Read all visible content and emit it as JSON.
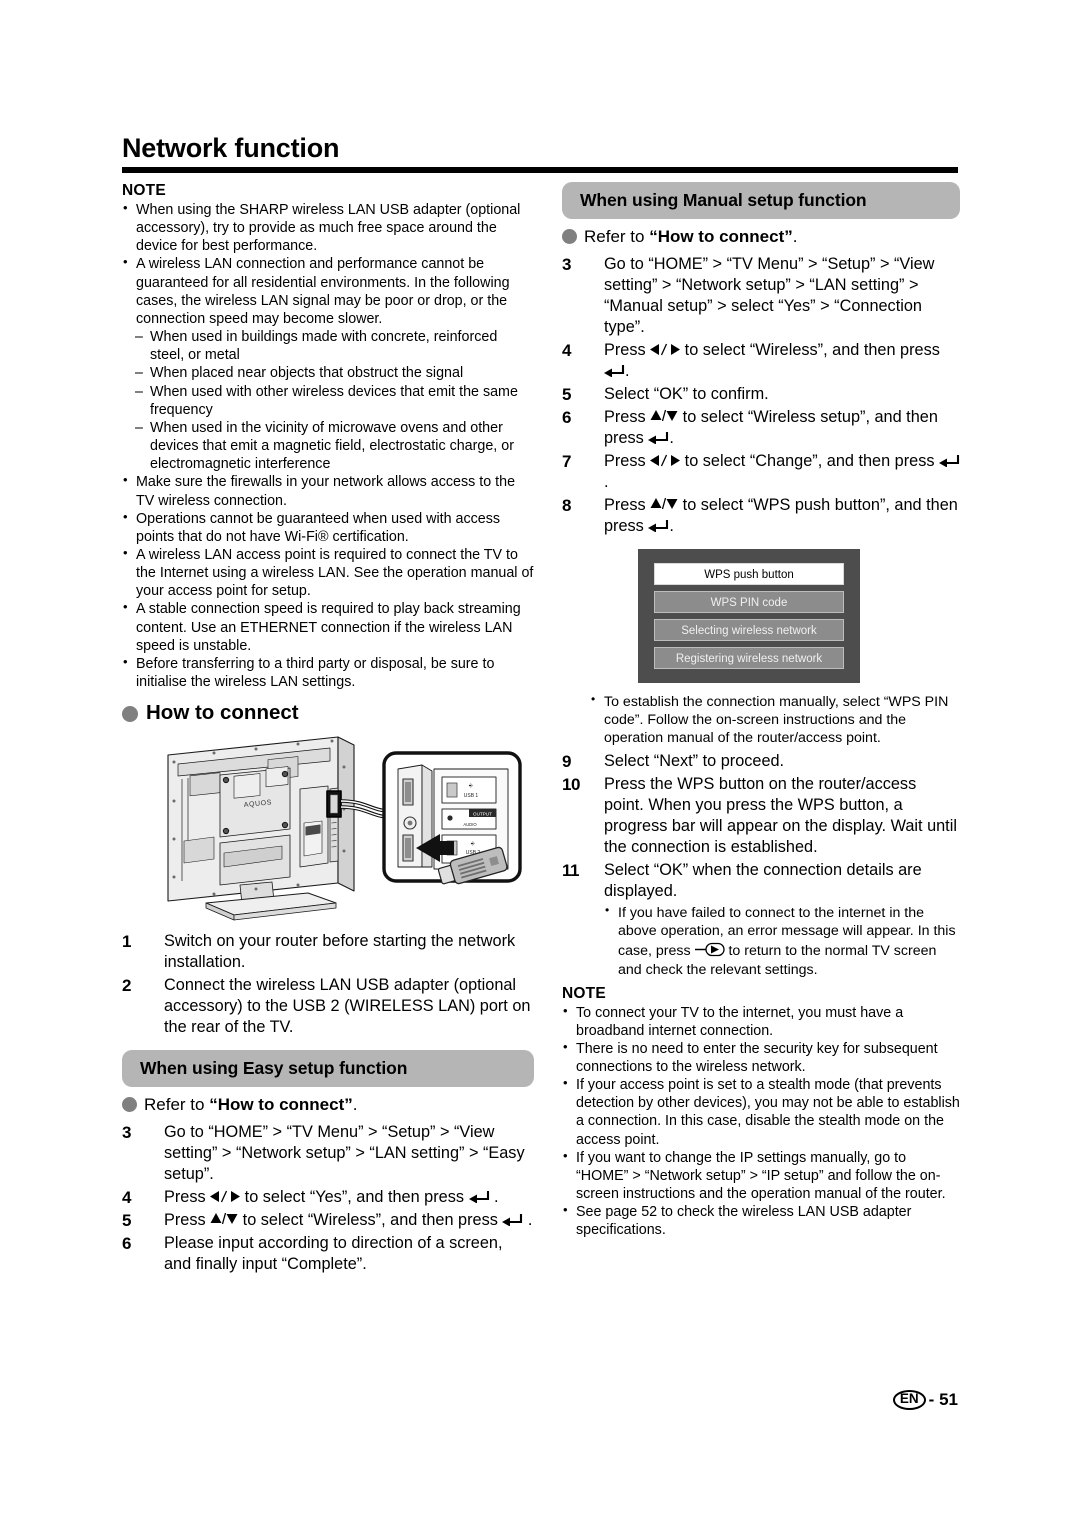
{
  "page": {
    "title": "Network function",
    "footer_lang": "EN",
    "footer_sep": "-",
    "footer_page": "51"
  },
  "left": {
    "note_label": "NOTE",
    "notes": [
      "When using the SHARP wireless LAN USB adapter (optional accessory), try to provide as much free space around the device for best performance.",
      "A wireless LAN connection and performance cannot be guaranteed for all residential environments. In the following cases, the wireless LAN signal may be poor or drop, or the connection speed may become slower."
    ],
    "sub_dashes": [
      "When used in buildings made with concrete, reinforced steel, or metal",
      "When placed near objects that obstruct the signal",
      "When used with other wireless devices that emit the same frequency",
      "When used in the vicinity of microwave ovens and other devices that emit a magnetic field, electrostatic charge, or electromagnetic interference"
    ],
    "notes_cont": [
      "Make sure the firewalls in your network allows access to the TV wireless connection.",
      "Operations cannot be guaranteed when used with access points that do not have Wi-Fi® certification.",
      "A wireless LAN access point is required to connect the TV to the Internet using a wireless LAN. See the operation manual of your access point for setup.",
      "A stable connection speed is required to play back streaming content. Use an ETHERNET connection if the wireless LAN speed is unstable.",
      "Before transferring to a third party or disposal, be sure to initialise the wireless LAN settings."
    ],
    "how_to_connect_heading": "How to connect",
    "figure": {
      "brand_label": "AQUOS",
      "port_label_usb1": "USB 1",
      "port_label_output": "OUTPUT",
      "port_label_usb2": "USB 2"
    },
    "steps": [
      {
        "num": "1",
        "text": "Switch on your router before starting the network installation."
      },
      {
        "num": "2",
        "text": "Connect the wireless LAN USB adapter (optional accessory) to the USB 2 (WIRELESS LAN) port on the rear of the TV."
      }
    ],
    "easy_bar": "When using Easy setup function",
    "easy_refer_prefix": "Refer to ",
    "easy_refer_bold": "“How to connect”",
    "easy_refer_suffix": ".",
    "easy_steps": {
      "s3_num": "3",
      "s3_text": "Go to “HOME” > “TV Menu” > “Setup” > “View setting” > “Network setup” > “LAN setting” > “Easy setup”.",
      "s4_num": "4",
      "s4_a": "Press ",
      "s4_b": " to select “Yes”, and then press ",
      "s4_c": " .",
      "s5_num": "5",
      "s5_a": "Press ",
      "s5_b": " to select “Wireless”, and then press ",
      "s5_c": " .",
      "s6_num": "6",
      "s6_text": "Please input according to direction of a screen, and finally input “Complete”."
    }
  },
  "right": {
    "manual_bar": "When using Manual setup function",
    "refer_prefix": "Refer to ",
    "refer_bold": "“How to connect”",
    "refer_suffix": ".",
    "steps": {
      "s3_num": "3",
      "s3_text": "Go to “HOME” > “TV Menu” > “Setup” > “View setting” > “Network setup” > “LAN setting” > “Manual setup” > select “Yes” > “Connection type”.",
      "s4_num": "4",
      "s4_a": "Press ",
      "s4_b": " to select “Wireless”, and then press ",
      "s4_c": ".",
      "s5_num": "5",
      "s5_text": "Select “OK” to confirm.",
      "s6_num": "6",
      "s6_a": "Press ",
      "s6_b": " to select “Wireless setup”, and then press ",
      "s6_c": ".",
      "s7_num": "7",
      "s7_a": "Press ",
      "s7_b": " to select “Change”, and then press ",
      "s7_c": ".",
      "s8_num": "8",
      "s8_a": "Press ",
      "s8_b": " to select “WPS push button”, and then press ",
      "s8_c": "."
    },
    "osd": {
      "items": [
        {
          "label": "WPS push button",
          "selected": true
        },
        {
          "label": "WPS PIN code",
          "selected": false
        },
        {
          "label": "Selecting wireless network",
          "selected": false
        },
        {
          "label": "Registering wireless network",
          "selected": false
        }
      ],
      "bg_color": "#4d4d4d",
      "selected_color": "#ffffff",
      "item_color": "#8c8c8c"
    },
    "after_osd_bullet": "To establish the connection manually, select “WPS PIN code”. Follow the on-screen instructions and the operation manual of the router/access point.",
    "steps2": {
      "s9_num": "9",
      "s9_text": "Select “Next” to proceed.",
      "s10_num": "10",
      "s10_text": "Press the WPS button on the router/access point. When you press the WPS button, a progress bar will appear on the display. Wait until the connection is established.",
      "s11_num": "11",
      "s11_text": "Select “OK” when the connection details are displayed.",
      "s11_bullet_a": "If you have failed to connect to the internet in the above operation, an error message will appear. In this case, press ",
      "s11_bullet_b": " to return to the normal TV screen and check the relevant settings."
    },
    "note_label": "NOTE",
    "notes": [
      "To connect your TV to the internet, you must have a broadband internet connection.",
      "There is no need to enter the security key for subsequent connections to the wireless network.",
      "If your access point is set to a stealth mode (that prevents detection by other devices), you may not be able to establish a connection. In this case, disable the stealth mode on the access point.",
      "If you want to change the IP settings manually, go to “HOME” > “Network setup” > “IP setup” and follow the on-screen instructions and the operation manual of the router.",
      "See page 52 to check the wireless LAN USB adapter specifications."
    ]
  }
}
